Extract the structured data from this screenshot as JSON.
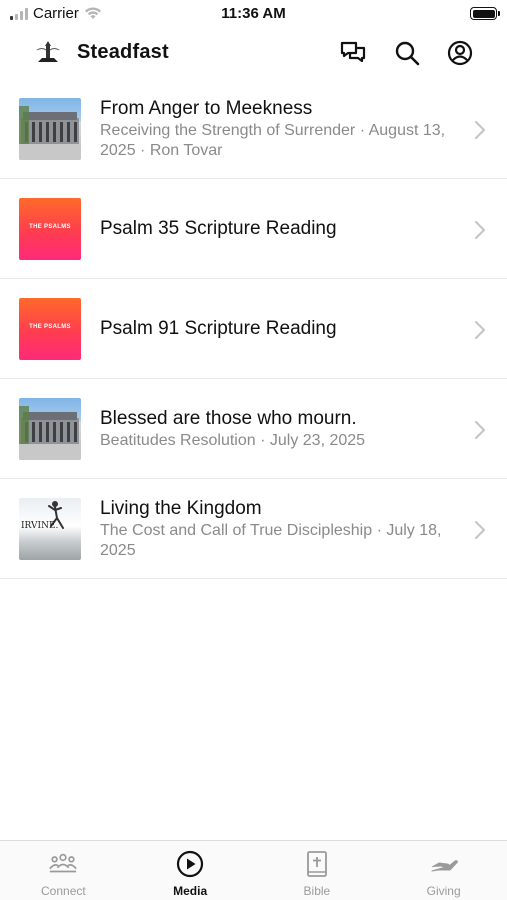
{
  "status_bar": {
    "carrier": "Carrier",
    "time": "11:36 AM"
  },
  "header": {
    "title": "Steadfast",
    "icons": [
      "chat-bubbles-icon",
      "search-icon",
      "account-icon"
    ]
  },
  "media_items": [
    {
      "title": "From Anger to Meekness",
      "subtitle": "Receiving the Strength of Surrender · August 13, 2025 · Ron Tovar",
      "thumbnail": "building"
    },
    {
      "title": "Psalm 35 Scripture Reading",
      "subtitle": "",
      "thumbnail": "psalms",
      "thumbnail_label": "THE PSALMS"
    },
    {
      "title": "Psalm 91 Scripture Reading",
      "subtitle": "",
      "thumbnail": "psalms",
      "thumbnail_label": "THE PSALMS"
    },
    {
      "title": "Blessed are those who mourn.",
      "subtitle": "Beatitudes Resolution · July 23, 2025",
      "thumbnail": "building"
    },
    {
      "title": "Living the Kingdom",
      "subtitle": "The Cost and Call of True Discipleship · July 18, 2025",
      "thumbnail": "irvine",
      "thumbnail_label": "IRVINE."
    }
  ],
  "tabs": [
    {
      "label": "Connect",
      "icon": "people-icon",
      "active": false
    },
    {
      "label": "Media",
      "icon": "play-circle-icon",
      "active": true
    },
    {
      "label": "Bible",
      "icon": "bible-icon",
      "active": false
    },
    {
      "label": "Giving",
      "icon": "giving-hand-icon",
      "active": false
    }
  ],
  "colors": {
    "accent": "#111111",
    "inactive_tab": "#9a9a9a",
    "subtitle": "#8a8a8a",
    "psalms_gradient_top": "#ff6a2a",
    "psalms_gradient_bottom": "#ff2a7a"
  }
}
